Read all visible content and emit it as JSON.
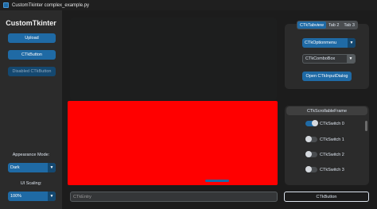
{
  "window": {
    "title": "CustomTkinter complex_example.py"
  },
  "sidebar": {
    "logo": "CustomTkinter",
    "buttons": [
      "Upload",
      "CTkButton",
      "Disabled CTkButton"
    ],
    "appearance_label": "Appearance Mode:",
    "appearance_value": "Dark",
    "scaling_label": "UI Scaling:",
    "scaling_value": "100%"
  },
  "main": {
    "entry_placeholder": "CTkEntry",
    "button_label": "CTkButton"
  },
  "tabview": {
    "tabs": [
      "CTkTabview",
      "Tab 2",
      "Tab 3"
    ],
    "option_menu": "CTkOptionmenu",
    "combobox": "CTkComboBox",
    "input_button": "Open CTkInputDialog"
  },
  "scrollable_frame": {
    "label": "CTkScrollableFrame",
    "switches": [
      {
        "label": "CTkSwitch 0",
        "on": true
      },
      {
        "label": "CTkSwitch 1",
        "on": false
      },
      {
        "label": "CTkSwitch 2",
        "on": false
      },
      {
        "label": "CTkSwitch 3",
        "on": false
      }
    ]
  },
  "colors": {
    "accent": "#1f6aa5",
    "canvas": "#ff0000",
    "background": "#1c1c1c",
    "panel": "#2b2b2b"
  }
}
